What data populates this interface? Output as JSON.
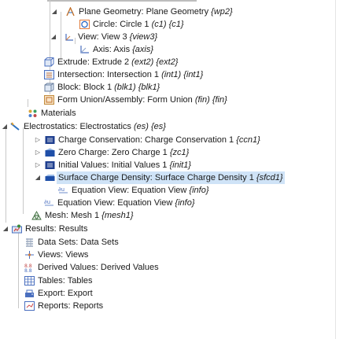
{
  "tree": {
    "rows": [
      {
        "name": "Plane Geometry: Plane Geometry ",
        "tag": "{wp2}"
      },
      {
        "name": "Circle: Circle 1 ",
        "tag": "(c1) {c1}"
      },
      {
        "name": "View: View 3 ",
        "tag": "{view3}"
      },
      {
        "name": "Axis: Axis ",
        "tag": "{axis}"
      },
      {
        "name": "Extrude: Extrude 2 ",
        "tag": "(ext2) {ext2}"
      },
      {
        "name": "Intersection: Intersection 1 ",
        "tag": "(int1) {int1}"
      },
      {
        "name": "Block: Block 1 ",
        "tag": "(blk1) {blk1}"
      },
      {
        "name": "Form Union/Assembly: Form Union ",
        "tag": "(fin) {fin}"
      },
      {
        "name": "Materials",
        "tag": ""
      },
      {
        "name": "Electrostatics: Electrostatics ",
        "tag": "(es) {es}"
      },
      {
        "name": "Charge Conservation: Charge Conservation 1 ",
        "tag": "{ccn1}"
      },
      {
        "name": "Zero Charge: Zero Charge 1 ",
        "tag": "{zc1}"
      },
      {
        "name": "Initial Values: Initial Values 1 ",
        "tag": "{init1}"
      },
      {
        "name": "Surface Charge Density: Surface Charge Density 1 ",
        "tag": "{sfcd1}"
      },
      {
        "name": "Equation View: Equation View ",
        "tag": "{info}"
      },
      {
        "name": "Equation View: Equation View ",
        "tag": "{info}"
      },
      {
        "name": "Mesh: Mesh 1 ",
        "tag": "{mesh1}"
      },
      {
        "name": "Results: Results",
        "tag": ""
      },
      {
        "name": "Data Sets: Data Sets",
        "tag": ""
      },
      {
        "name": "Views: Views",
        "tag": ""
      },
      {
        "name": "Derived Values: Derived Values",
        "tag": ""
      },
      {
        "name": "Tables: Tables",
        "tag": ""
      },
      {
        "name": "Export: Export",
        "tag": ""
      },
      {
        "name": "Reports: Reports",
        "tag": ""
      }
    ],
    "icons": [
      "plane-geometry-icon",
      "circle-icon",
      "view-icon",
      "axis-icon",
      "extrude-icon",
      "intersection-icon",
      "block-icon",
      "form-union-icon",
      "materials-icon",
      "electrostatics-icon",
      "charge-conservation-icon",
      "zero-charge-icon",
      "initial-values-icon",
      "surface-charge-density-icon",
      "equation-view-icon",
      "equation-view-icon",
      "mesh-icon",
      "results-icon",
      "data-sets-icon",
      "views-icon",
      "derived-values-icon",
      "tables-icon",
      "export-icon",
      "reports-icon"
    ],
    "selected_index": 13
  },
  "colors": {
    "selection": "#cfe3f7",
    "tree_line": "#c8c8c8"
  }
}
